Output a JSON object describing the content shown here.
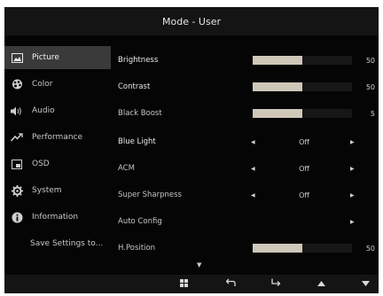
{
  "title": "Mode - User",
  "sidebar": {
    "items": [
      {
        "label": "Picture",
        "icon": "picture-icon",
        "active": true
      },
      {
        "label": "Color",
        "icon": "color-palette-icon",
        "active": false
      },
      {
        "label": "Audio",
        "icon": "speaker-icon",
        "active": false
      },
      {
        "label": "Performance",
        "icon": "performance-icon",
        "active": false
      },
      {
        "label": "OSD",
        "icon": "osd-icon",
        "active": false
      },
      {
        "label": "System",
        "icon": "gear-icon",
        "active": false
      },
      {
        "label": "Information",
        "icon": "info-icon",
        "active": false
      }
    ],
    "save_label": "Save Settings to..."
  },
  "settings": [
    {
      "label": "Brightness",
      "type": "slider",
      "value": "50",
      "level": 0.5
    },
    {
      "label": "Contrast",
      "type": "slider",
      "value": "50",
      "level": 0.5
    },
    {
      "label": "Black Boost",
      "type": "slider",
      "value": "5",
      "level": 0.5
    },
    {
      "label": "Blue Light",
      "type": "select",
      "value": "Off"
    },
    {
      "label": "ACM",
      "type": "select",
      "value": "Off"
    },
    {
      "label": "Super Sharpness",
      "type": "select",
      "value": "Off"
    },
    {
      "label": "Auto Config",
      "type": "action"
    },
    {
      "label": "H.Position",
      "type": "slider",
      "value": "50",
      "level": 0.5
    }
  ],
  "bottom_buttons": [
    {
      "icon": "menu-grid-icon"
    },
    {
      "icon": "back-icon"
    },
    {
      "icon": "enter-icon"
    },
    {
      "icon": "up-icon"
    },
    {
      "icon": "down-icon"
    }
  ],
  "colors": {
    "bg": "#050505",
    "bar_fill": "#cfc7b8",
    "active_item": "#3a3a3a"
  }
}
